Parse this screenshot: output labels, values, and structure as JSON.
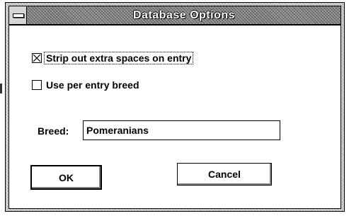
{
  "window": {
    "title": "Database Options"
  },
  "options": {
    "strip_spaces": {
      "label": "Strip out extra spaces on entry",
      "checked": true
    },
    "per_entry_breed": {
      "label": "Use per entry breed",
      "checked": false
    }
  },
  "breed": {
    "label": "Breed:",
    "value": "Pomeranians"
  },
  "buttons": {
    "ok_label": "OK",
    "cancel_label": "Cancel"
  },
  "icons": {
    "system_menu": "system-menu-icon",
    "checked_mark": "x-check-icon"
  }
}
